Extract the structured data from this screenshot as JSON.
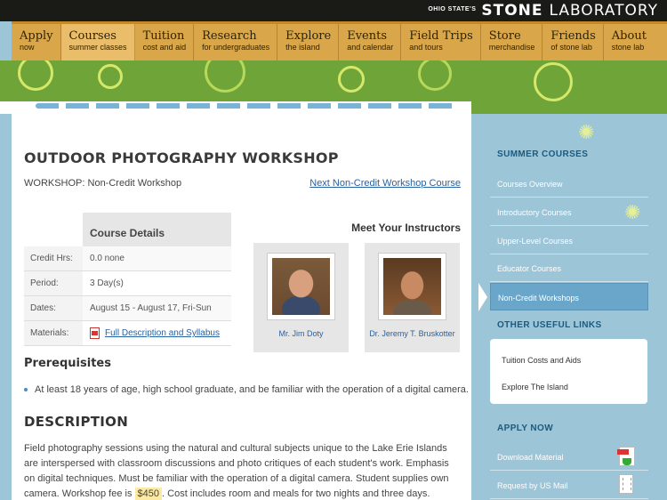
{
  "brand": {
    "prefix": "OHIO STATE'S",
    "name": "STONE",
    "suffix": "LABORATORY"
  },
  "nav": [
    {
      "label": "Apply",
      "sub": "now"
    },
    {
      "label": "Courses",
      "sub": "summer classes",
      "active": true
    },
    {
      "label": "Tuition",
      "sub": "cost and aid"
    },
    {
      "label": "Research",
      "sub": "for undergraduates"
    },
    {
      "label": "Explore",
      "sub": "the island"
    },
    {
      "label": "Events",
      "sub": "and calendar"
    },
    {
      "label": "Field Trips",
      "sub": "and tours"
    },
    {
      "label": "Store",
      "sub": "merchandise"
    },
    {
      "label": "Friends",
      "sub": "of stone lab"
    },
    {
      "label": "About",
      "sub": "stone lab"
    }
  ],
  "page": {
    "title": "OUTDOOR PHOTOGRAPHY WORKSHOP",
    "workshop_type": "WORKSHOP: Non-Credit Workshop",
    "next_link": "Next Non-Credit Workshop Course"
  },
  "details": {
    "header": "Course Details",
    "rows": [
      {
        "k": "Credit Hrs:",
        "v": "0.0 none"
      },
      {
        "k": "Period:",
        "v": "3 Day(s)"
      },
      {
        "k": "Dates:",
        "v": "August 15 - August 17, Fri-Sun"
      },
      {
        "k": "Materials:",
        "v": "Full Description and Syllabus"
      }
    ]
  },
  "instructors": {
    "heading": "Meet Your Instructors",
    "list": [
      {
        "name": "Mr. Jim Doty"
      },
      {
        "name": "Dr. Jeremy T. Bruskotter"
      }
    ]
  },
  "prerequisites": {
    "heading": "Prerequisites",
    "item": "At least 18 years of age, high school graduate, and be familiar with the operation of a digital camera."
  },
  "description": {
    "heading": "DESCRIPTION",
    "text_before_fee": "Field photography sessions using the natural and cultural subjects unique to the Lake Erie Islands are interspersed with classroom discussions and photo critiques of each student's work. Emphasis on digital techniques. Must be familiar with the operation of a digital camera. Student supplies own camera. Workshop fee is",
    "fee": "$450",
    "text_after_fee": ". Cost includes room and meals for two nights and three days."
  },
  "sidebar": {
    "summer_title": "SUMMER COURSES",
    "summer_items": [
      "Courses Overview",
      "Introductory Courses",
      "Upper-Level Courses",
      "Educator Courses",
      "Non-Credit Workshops"
    ],
    "useful_title": "OTHER USEFUL LINKS",
    "useful_items": [
      "Tuition Costs and Aids",
      "Explore The Island"
    ],
    "apply_title": "APPLY NOW",
    "apply_items": [
      "Download Material",
      "Request by US Mail"
    ]
  },
  "colors": {
    "nav": "#d9a64a",
    "banner": "#6fa538",
    "sidebar": "#9cc5d8",
    "link": "#2862a0"
  }
}
